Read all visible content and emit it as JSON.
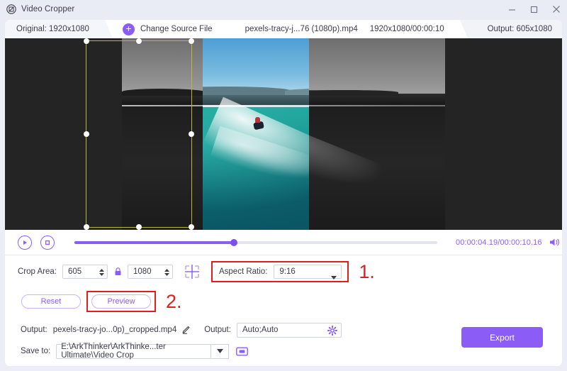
{
  "window": {
    "title": "Video Cropper",
    "app_icon": "video-cropper-icon",
    "minimize_icon": "minimize-icon",
    "maximize_icon": "maximize-icon",
    "close_icon": "close-icon"
  },
  "topbar": {
    "original_label": "Original: 1920x1080",
    "change_source_label": "Change Source File",
    "plus_icon": "plus-icon",
    "file_name": "pexels-tracy-j...76 (1080p).mp4",
    "file_meta": "1920x1080/00:00:10",
    "output_label": "Output: 605x1080"
  },
  "preview": {
    "crop_border_color": "#b8b83a",
    "handle_color": "#ffffff",
    "stage_bg": "#242424",
    "scene": "jet ski on turquoise sea with shoreline"
  },
  "playback": {
    "play_icon": "play-icon",
    "stop_icon": "stop-icon",
    "progress_percent": 44,
    "timecode": "00:00:04.19/00:00:10.16",
    "volume_icon": "volume-icon",
    "accent": "#8b5cf6"
  },
  "crop_controls": {
    "crop_area_label": "Crop Area:",
    "width_value": "605",
    "height_value": "1080",
    "lock_icon": "lock-icon",
    "spinner_icon": "spinner-up-down-icon",
    "crosshair_icon": "crosshair-icon",
    "aspect_ratio_label": "Aspect Ratio:",
    "aspect_ratio_value": "9:16",
    "dropdown_icon": "chevron-down-icon",
    "step_marker_1": "1.",
    "highlight_color": "#e11d1d"
  },
  "action_buttons": {
    "reset_label": "Reset",
    "preview_label": "Preview",
    "step_marker_2": "2."
  },
  "output": {
    "output_label": "Output:",
    "output_file": "pexels-tracy-jo...0p)_cropped.mp4",
    "edit_icon": "pencil-icon",
    "format_label": "Output:",
    "format_value": "Auto;Auto",
    "settings_icon": "gear-icon",
    "save_to_label": "Save to:",
    "save_path": "E:\\ArkThinker\\ArkThinke...ter Ultimate\\Video Crop",
    "path_dropdown_icon": "chevron-down-icon",
    "folder_icon": "folder-icon",
    "export_label": "Export",
    "export_color": "#8b5cf6"
  }
}
